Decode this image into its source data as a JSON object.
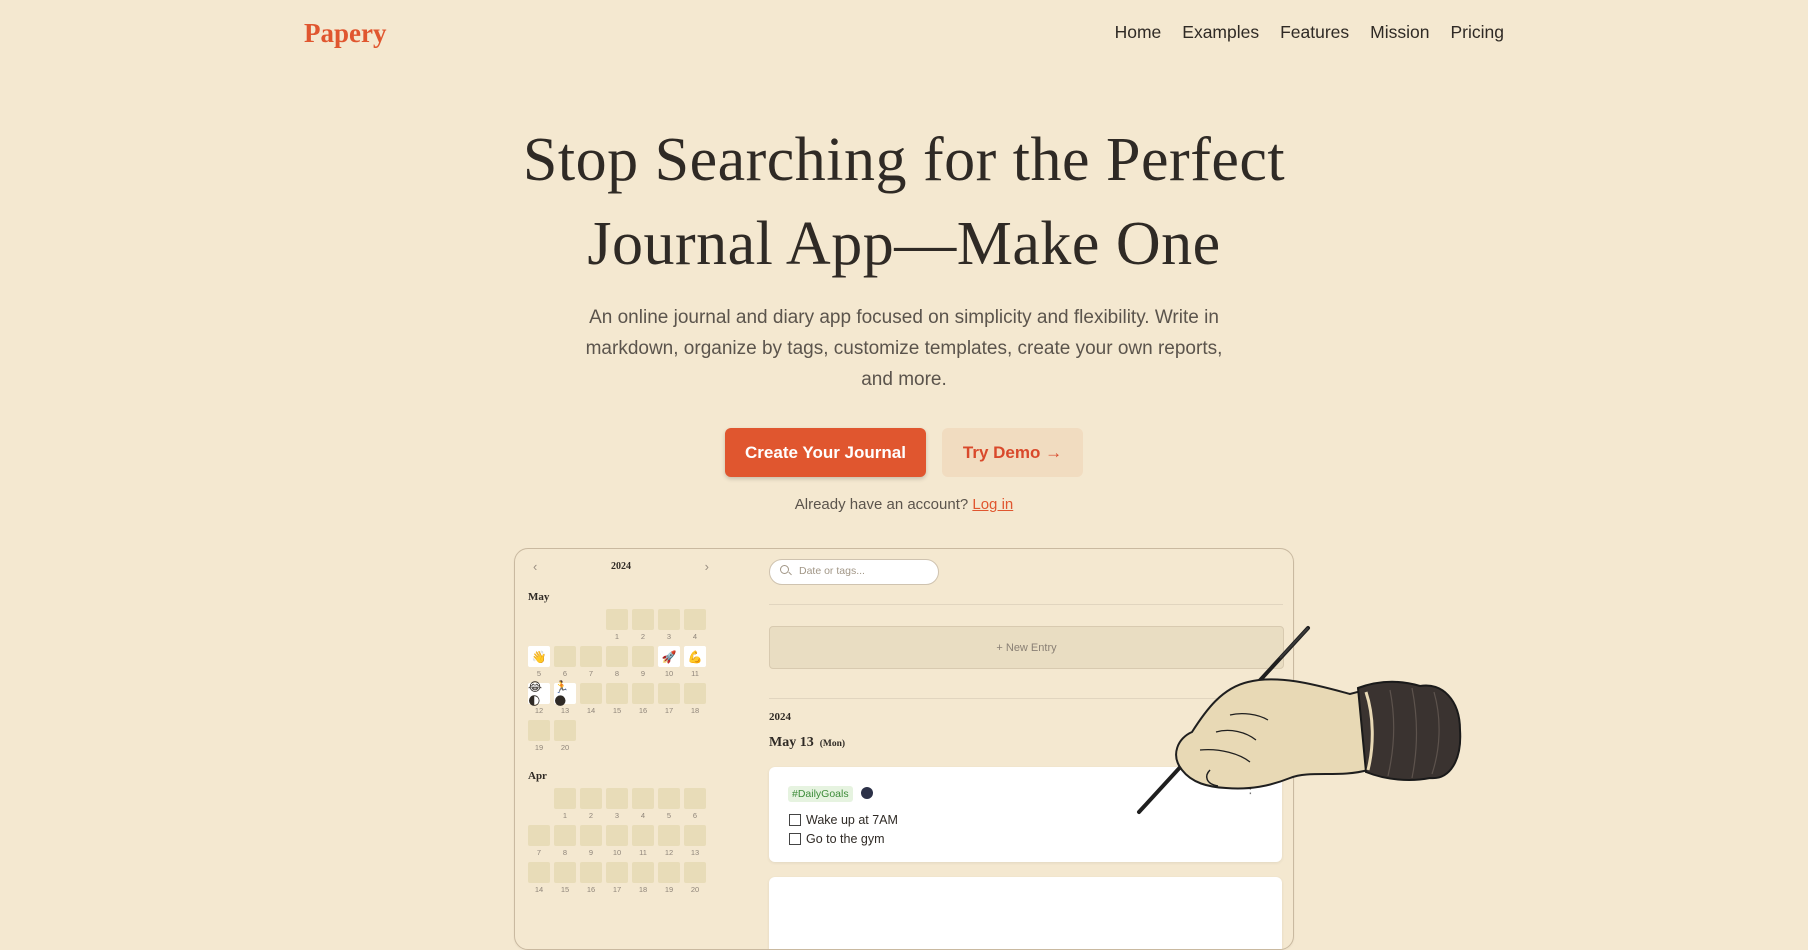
{
  "brand": {
    "name": "Papery"
  },
  "nav": {
    "items": [
      "Home",
      "Examples",
      "Features",
      "Mission",
      "Pricing"
    ]
  },
  "hero": {
    "title_line1": "Stop Searching for the Perfect",
    "title_line2": "Journal App—Make One",
    "subtitle": "An online journal and diary app focused on simplicity and flexibility. Write in markdown, organize by tags, customize templates, create your own reports, and more.",
    "primary_button": "Create Your Journal",
    "secondary_button": "Try Demo →",
    "account_text": "Already have an account?",
    "login_link": "Log in"
  },
  "mockup": {
    "calendar": {
      "year": "2024",
      "prev_icon": "‹",
      "next_icon": "›",
      "months": [
        {
          "label": "May",
          "days": [
            {
              "n": "1",
              "c": 3,
              "r": 0
            },
            {
              "n": "2",
              "c": 4,
              "r": 0
            },
            {
              "n": "3",
              "c": 5,
              "r": 0
            },
            {
              "n": "4",
              "c": 6,
              "r": 0
            },
            {
              "n": "5",
              "c": 0,
              "r": 1,
              "e": "👋"
            },
            {
              "n": "6",
              "c": 1,
              "r": 1
            },
            {
              "n": "7",
              "c": 2,
              "r": 1
            },
            {
              "n": "8",
              "c": 3,
              "r": 1
            },
            {
              "n": "9",
              "c": 4,
              "r": 1
            },
            {
              "n": "10",
              "c": 5,
              "r": 1,
              "e": "🚀"
            },
            {
              "n": "11",
              "c": 6,
              "r": 1,
              "e": "💪"
            },
            {
              "n": "12",
              "c": 0,
              "r": 2,
              "e": "😂🌓"
            },
            {
              "n": "13",
              "c": 1,
              "r": 2,
              "e": "🏃🌑"
            },
            {
              "n": "14",
              "c": 2,
              "r": 2
            },
            {
              "n": "15",
              "c": 3,
              "r": 2
            },
            {
              "n": "16",
              "c": 4,
              "r": 2
            },
            {
              "n": "17",
              "c": 5,
              "r": 2
            },
            {
              "n": "18",
              "c": 6,
              "r": 2
            },
            {
              "n": "19",
              "c": 0,
              "r": 3
            },
            {
              "n": "20",
              "c": 1,
              "r": 3
            }
          ]
        },
        {
          "label": "Apr",
          "days": [
            {
              "n": "1",
              "c": 1,
              "r": 0
            },
            {
              "n": "2",
              "c": 2,
              "r": 0
            },
            {
              "n": "3",
              "c": 3,
              "r": 0
            },
            {
              "n": "4",
              "c": 4,
              "r": 0
            },
            {
              "n": "5",
              "c": 5,
              "r": 0
            },
            {
              "n": "6",
              "c": 6,
              "r": 0
            },
            {
              "n": "7",
              "c": 0,
              "r": 1
            },
            {
              "n": "8",
              "c": 1,
              "r": 1
            },
            {
              "n": "9",
              "c": 2,
              "r": 1
            },
            {
              "n": "10",
              "c": 3,
              "r": 1
            },
            {
              "n": "11",
              "c": 4,
              "r": 1
            },
            {
              "n": "12",
              "c": 5,
              "r": 1
            },
            {
              "n": "13",
              "c": 6,
              "r": 1
            },
            {
              "n": "14",
              "c": 0,
              "r": 2
            },
            {
              "n": "15",
              "c": 1,
              "r": 2
            },
            {
              "n": "16",
              "c": 2,
              "r": 2
            },
            {
              "n": "17",
              "c": 3,
              "r": 2
            },
            {
              "n": "18",
              "c": 4,
              "r": 2
            },
            {
              "n": "19",
              "c": 5,
              "r": 2
            },
            {
              "n": "20",
              "c": 6,
              "r": 2
            }
          ]
        }
      ]
    },
    "search_placeholder": "Date or tags...",
    "new_entry": "+ New Entry",
    "year": "2024",
    "date": "May 13",
    "weekday": "(Mon)",
    "entry": {
      "tag": "#DailyGoals",
      "todos": [
        "Wake up at 7AM",
        "Go to the gym"
      ],
      "menu_icon": "⋮"
    }
  },
  "colors": {
    "accent": "#e0562f",
    "background": "#f4e8d0",
    "secondary_button_bg": "#f1dcc0"
  }
}
